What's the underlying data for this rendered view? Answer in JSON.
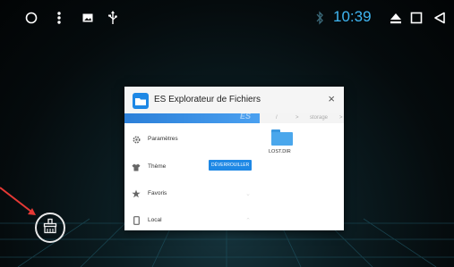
{
  "status_bar": {
    "time": "10:39",
    "icons": [
      "circle-home-icon",
      "more-vert-icon",
      "image-notification-icon",
      "usb-icon",
      "bluetooth-icon",
      "eject-icon",
      "square-recents-icon",
      "triangle-back-icon"
    ]
  },
  "recents_card": {
    "app_title": "ES Explorateur de Fichiers",
    "close_label": "×",
    "drawer_watermark": "ES",
    "drawer_items": [
      {
        "label": "Paramètres",
        "icon": "gear-icon"
      },
      {
        "label": "Thème",
        "icon": "shirt-icon",
        "button": "DÉVERROUILLER"
      },
      {
        "label": "Favoris",
        "icon": "star-icon"
      },
      {
        "label": "Local",
        "icon": "phone-icon"
      }
    ],
    "path": [
      "/",
      ">",
      "storage",
      ">"
    ],
    "folder": {
      "name": "LOST.DIR",
      "icon": "folder-icon"
    }
  },
  "clear_button": {
    "icon": "broom-icon"
  },
  "colors": {
    "accent": "#3fb6f2",
    "button_blue": "#1e88e5",
    "arrow": "#e53935"
  }
}
